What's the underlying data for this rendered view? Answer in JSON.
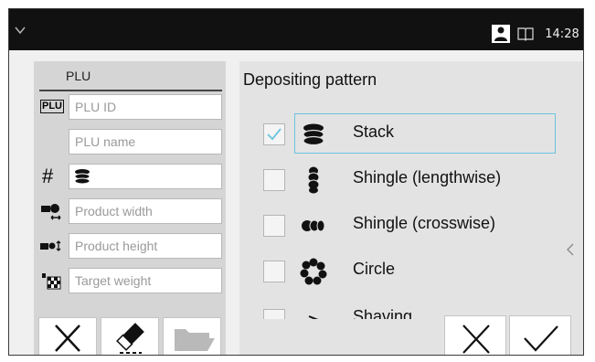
{
  "topbar": {
    "time": "14:28",
    "icons": [
      "chevron-down-icon",
      "user-icon",
      "book-icon"
    ]
  },
  "plu_panel": {
    "title": "PLU",
    "fields": {
      "plu_id": {
        "placeholder": "PLU ID",
        "badge": "PLU"
      },
      "plu_name": {
        "placeholder": "PLU name"
      },
      "count": {
        "symbol": "#"
      },
      "product_width": {
        "placeholder": "Product width"
      },
      "product_height": {
        "placeholder": "Product height"
      },
      "target_weight": {
        "placeholder": "Target weight"
      }
    },
    "buttons": [
      "close-icon",
      "eraser-icon",
      "folder-icon"
    ]
  },
  "pattern_panel": {
    "title": "Depositing pattern",
    "options": [
      {
        "label": "Stack",
        "checked": true,
        "selected": true,
        "icon": "stack-icon"
      },
      {
        "label": "Shingle (lengthwise)",
        "checked": false,
        "icon": "shingle-lengthwise-icon"
      },
      {
        "label": "Shingle (crosswise)",
        "checked": false,
        "icon": "shingle-crosswise-icon"
      },
      {
        "label": "Circle",
        "checked": false,
        "icon": "circle-pattern-icon"
      },
      {
        "label": "Shaving",
        "checked": false,
        "icon": "shaving-icon"
      }
    ],
    "buttons": [
      "cancel-icon",
      "confirm-icon"
    ]
  },
  "colors": {
    "topbar": "#111111",
    "selection_border": "#6cc3e0",
    "checkmark": "#6cc3e0"
  }
}
